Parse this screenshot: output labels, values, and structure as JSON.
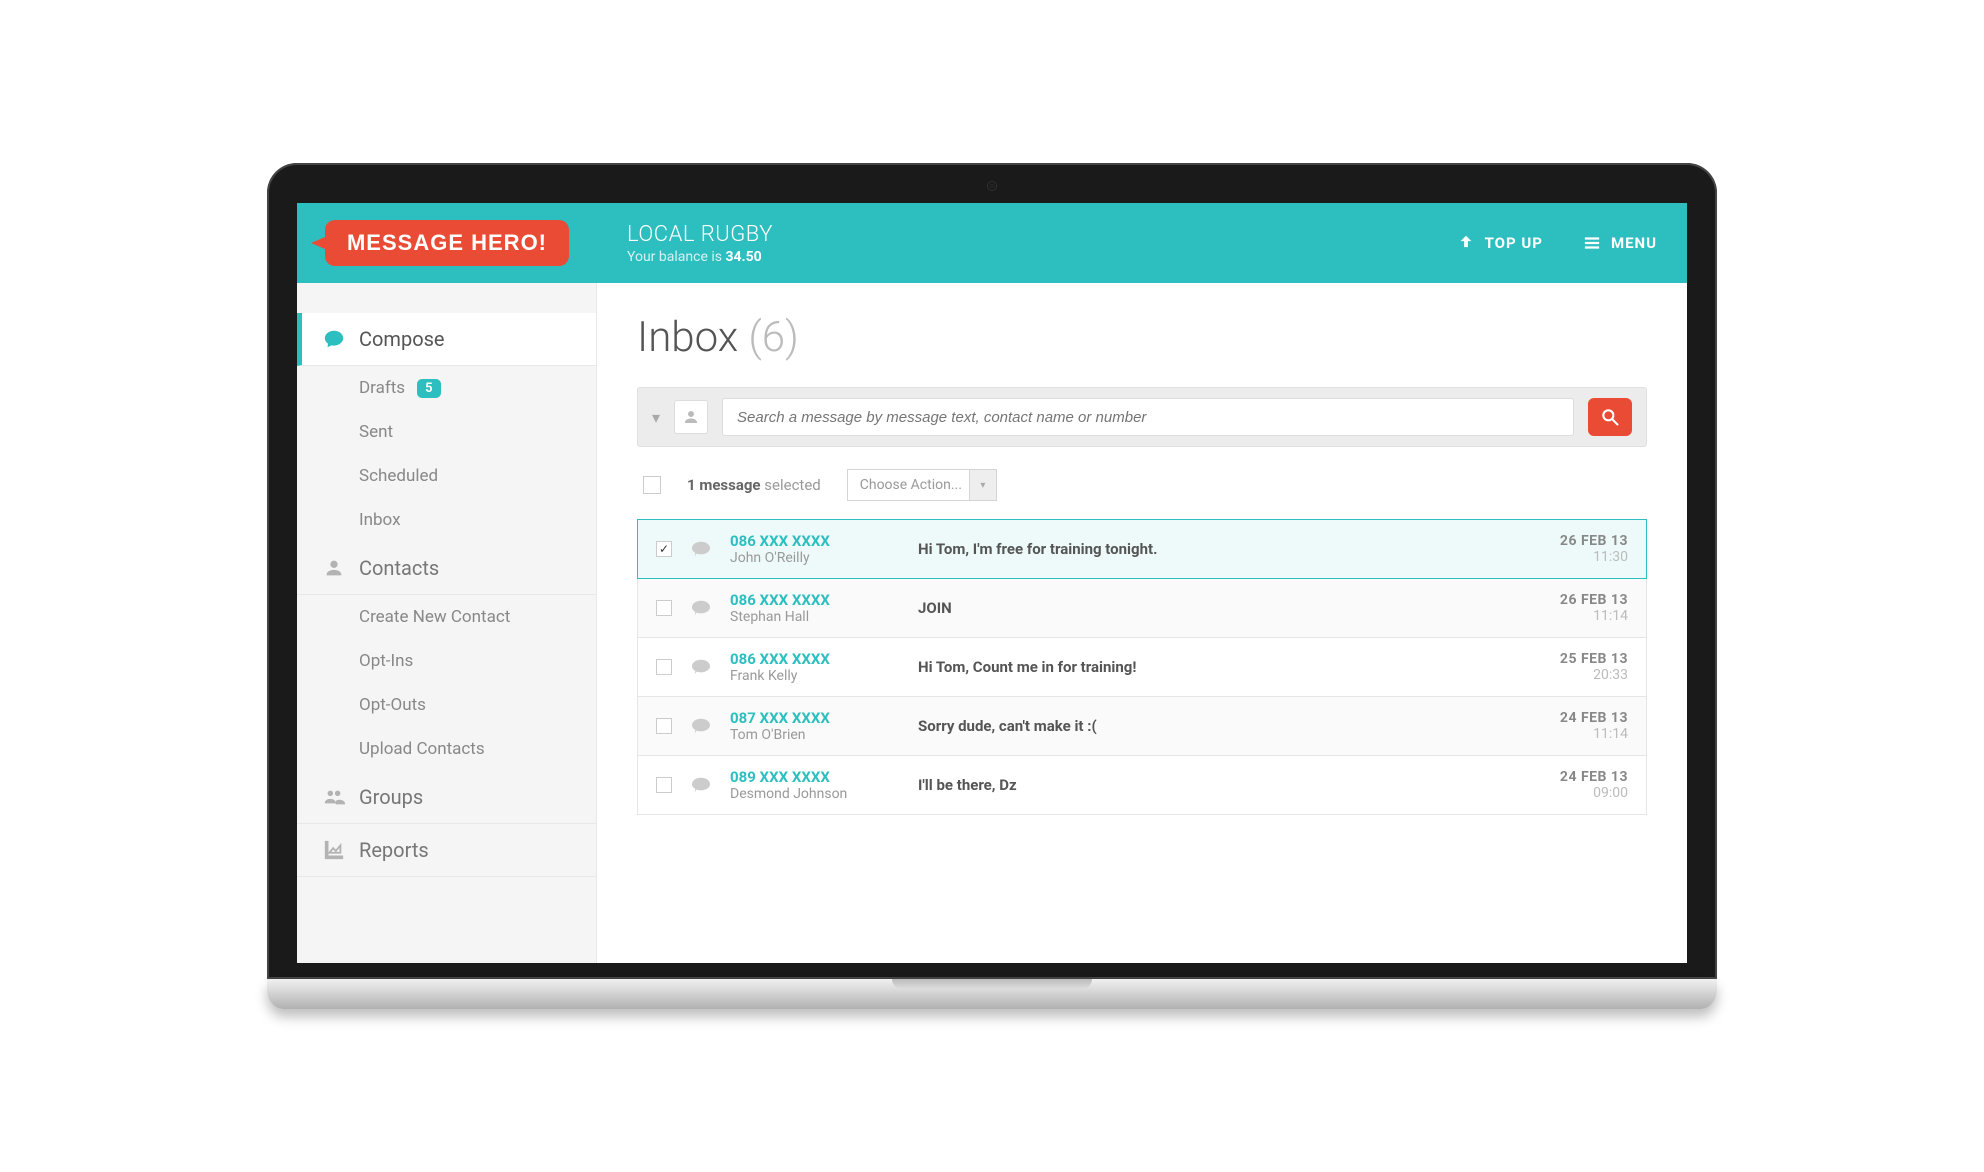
{
  "brand": {
    "logo_text": "MESSAGE HERO!"
  },
  "header": {
    "account_name": "LOCAL RUGBY",
    "balance_prefix": "Your balance is ",
    "balance": "34.50",
    "topup_label": "TOP UP",
    "menu_label": "MENU"
  },
  "sidebar": {
    "compose": {
      "label": "Compose",
      "subs": {
        "drafts": "Drafts",
        "drafts_badge": "5",
        "sent": "Sent",
        "scheduled": "Scheduled",
        "inbox": "Inbox"
      }
    },
    "contacts": {
      "label": "Contacts",
      "subs": {
        "create": "Create New Contact",
        "optins": "Opt-Ins",
        "optouts": "Opt-Outs",
        "upload": "Upload Contacts"
      }
    },
    "groups": {
      "label": "Groups"
    },
    "reports": {
      "label": "Reports"
    }
  },
  "inbox": {
    "title": "Inbox",
    "count": "(6)",
    "search_placeholder": "Search a message by message text, contact name or number",
    "selected_count": "1 message",
    "selected_suffix": " selected",
    "action_placeholder": "Choose Action...",
    "messages": [
      {
        "phone": "086 XXX XXXX",
        "name": "John O'Reilly",
        "text": "Hi Tom, I'm free for training tonight.",
        "date": "26 FEB 13",
        "time": "11:30",
        "checked": true
      },
      {
        "phone": "086 XXX XXXX",
        "name": "Stephan Hall",
        "text": "JOIN",
        "date": "26 FEB 13",
        "time": "11:14",
        "checked": false
      },
      {
        "phone": "086 XXX XXXX",
        "name": "Frank Kelly",
        "text": "Hi Tom, Count me in for training!",
        "date": "25 FEB 13",
        "time": "20:33",
        "checked": false
      },
      {
        "phone": "087 XXX XXXX",
        "name": "Tom O'Brien",
        "text": "Sorry dude, can't make it :(",
        "date": "24 FEB 13",
        "time": "11:14",
        "checked": false
      },
      {
        "phone": "089 XXX XXXX",
        "name": "Desmond Johnson",
        "text": "I'll be there, Dz",
        "date": "24 FEB 13",
        "time": "09:00",
        "checked": false
      }
    ]
  }
}
